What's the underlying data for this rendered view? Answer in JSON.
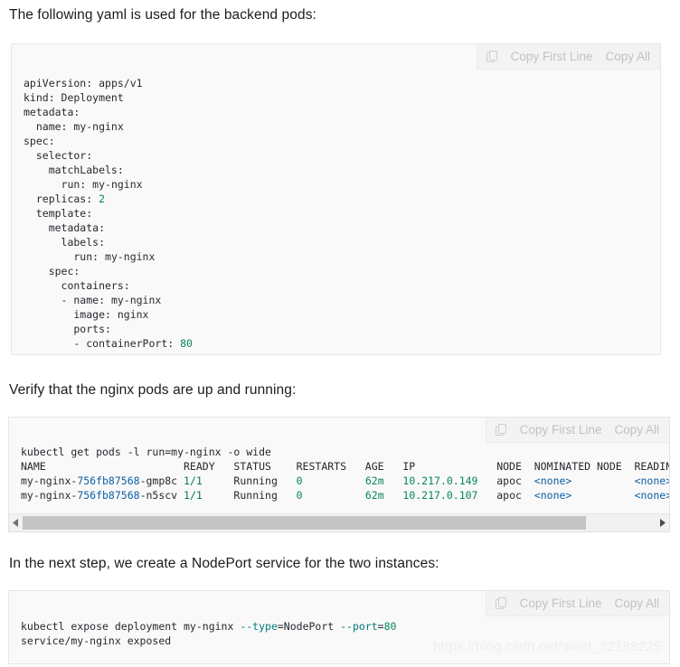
{
  "paragraphs": {
    "intro_yaml": "The following yaml is used for the backend pods:",
    "verify_pods": "Verify that the nginx pods are up and running:",
    "nodeport": "In the next step, we create a NodePort service for the two instances:"
  },
  "toolbar": {
    "copy_icon": "copy-icon",
    "copy_first_line": "Copy First Line",
    "copy_all": "Copy All"
  },
  "code_blocks": {
    "yaml": {
      "language": "yaml",
      "lines": [
        "apiVersion: apps/v1",
        "kind: Deployment",
        "metadata:",
        "  name: my-nginx",
        "spec:",
        "  selector:",
        "    matchLabels:",
        "      run: my-nginx",
        "  replicas: 2",
        "  template:",
        "    metadata:",
        "      labels:",
        "        run: my-nginx",
        "    spec:",
        "      containers:",
        "      - name: my-nginx",
        "        image: nginx",
        "        ports:",
        "        - containerPort: 80"
      ]
    },
    "pods": {
      "language": "shell",
      "command": "kubectl get pods -l run=my-nginx -o wide",
      "table": {
        "headers": [
          "NAME",
          "READY",
          "STATUS",
          "RESTARTS",
          "AGE",
          "IP",
          "NODE",
          "NOMINATED NODE",
          "READINESS GATES"
        ],
        "header_clipped": "READI",
        "rows": [
          {
            "name": "my-nginx-756fb87568-gmp8c",
            "ready": "1/1",
            "status": "Running",
            "restarts": "0",
            "age": "62m",
            "ip": "10.217.0.149",
            "node": "apoc",
            "nominated_node": "<none>",
            "readiness_gates": "<none>",
            "readiness_gates_clipped": "<none"
          },
          {
            "name": "my-nginx-756fb87568-n5scv",
            "ready": "1/1",
            "status": "Running",
            "restarts": "0",
            "age": "62m",
            "ip": "10.217.0.107",
            "node": "apoc",
            "nominated_node": "<none>",
            "readiness_gates": "<none>",
            "readiness_gates_clipped": "<none"
          }
        ]
      }
    },
    "expose": {
      "language": "shell",
      "command": "kubectl expose deployment my-nginx --type=NodePort --port=80",
      "output": "service/my-nginx exposed"
    }
  },
  "scrollbar": {
    "left_arrow": "triangle-left-icon",
    "right_arrow": "triangle-right-icon",
    "thumb_fraction_percent": "89"
  },
  "watermark": "https://blog.csdn.net/sinat_32188225",
  "colors": {
    "code_background": "#f9f9f9",
    "code_border": "#e6e6e6",
    "toolbar_background": "#f3f3f3",
    "toolbar_text": "#c2c2c2",
    "number_token": "#098658",
    "flag_token": "#007a7a",
    "id_token": "#0b5fa5",
    "body_text": "#1c1c1c",
    "watermark": "#eeeeee"
  }
}
